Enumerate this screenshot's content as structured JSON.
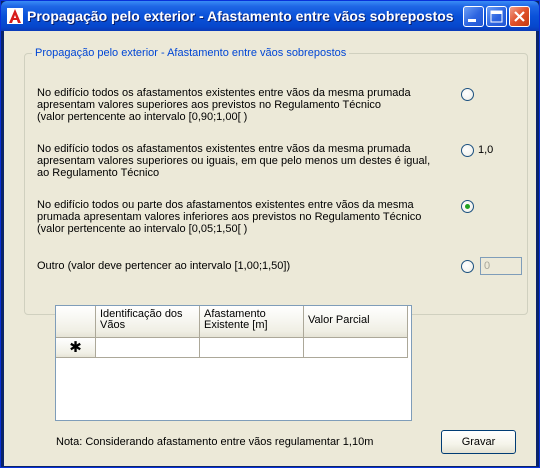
{
  "window": {
    "title": "Propagação pelo exterior - Afastamento entre vãos sobrepostos"
  },
  "group": {
    "title": "Propagação pelo exterior - Afastamento entre vãos sobrepostos",
    "options": [
      {
        "lines": [
          "No edifício todos os afastamentos existentes entre vãos da mesma prumada",
          "apresentam valores superiores aos previstos no Regulamento Técnico",
          "(valor pertencente ao intervalo  [0,90;1,00[ )"
        ],
        "selected": false,
        "radio_label": ""
      },
      {
        "lines": [
          "No edifício todos os afastamentos existentes entre vãos da mesma prumada",
          "apresentam valores superiores ou iguais, em que pelo menos um destes é igual,",
          "ao Regulamento Técnico"
        ],
        "selected": false,
        "radio_label": "1,0"
      },
      {
        "lines": [
          "No edifício todos ou parte dos afastamentos existentes entre vãos da mesma",
          "prumada apresentam valores inferiores aos previstos no Regulamento Técnico",
          "(valor pertencente ao intervalo  [0,05;1,50[ )"
        ],
        "selected": true,
        "radio_label": ""
      },
      {
        "lines": [
          "Outro (valor deve pertencer ao intervalo [1,00;1,50])"
        ],
        "selected": false,
        "radio_label": "",
        "input_value": "0"
      }
    ]
  },
  "table": {
    "headers": [
      [
        "Identificação dos",
        "Vãos"
      ],
      [
        "Afastamento",
        "Existente [m]"
      ],
      [
        "Valor Parcial"
      ]
    ],
    "new_row_marker": "✱",
    "rows": [
      [
        "",
        "",
        ""
      ]
    ]
  },
  "footer": {
    "note": "Nota: Considerando afastamento entre vãos regulamentar 1,10m",
    "save_label": "Gravar"
  },
  "colors": {
    "titlebar": "#0a52d9",
    "legend_text": "#0046d5",
    "radio_selected": "#21a121",
    "client_bg": "#ece9d8"
  },
  "icons": {
    "app": "app-logo-icon",
    "minimize": "minimize-icon",
    "maximize": "maximize-icon",
    "close": "close-icon"
  }
}
